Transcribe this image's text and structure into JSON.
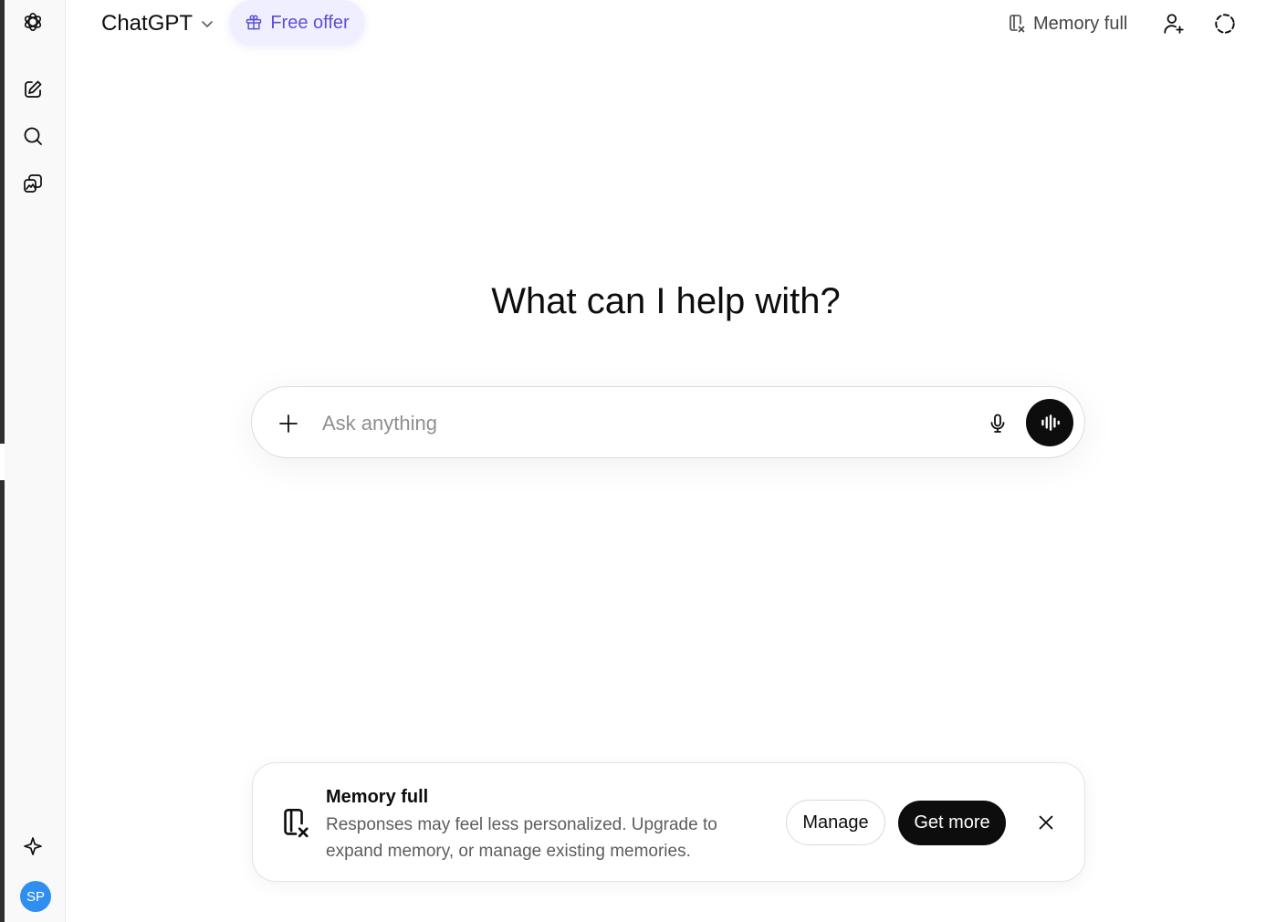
{
  "header": {
    "model_title": "ChatGPT",
    "free_offer_label": "Free offer",
    "memory_status_label": "Memory full"
  },
  "main": {
    "headline": "What can I help with?",
    "composer": {
      "placeholder": "Ask anything"
    }
  },
  "banner": {
    "title": "Memory full",
    "body": "Responses may feel less personalized. Upgrade to expand memory, or manage existing memories.",
    "manage_label": "Manage",
    "get_more_label": "Get more"
  },
  "user": {
    "initials": "SP"
  },
  "colors": {
    "accent": "#5b50d6",
    "offer_bg": "#f0efff",
    "avatar": "#2f8ff0",
    "primary_button": "#0d0d0d"
  },
  "icons": {
    "logo": "openai-logo-icon",
    "new_chat": "new-chat-icon",
    "search": "search-icon",
    "library": "library-icon",
    "sparkle": "sparkle-icon",
    "gift": "gift-icon",
    "memory": "memory-full-icon",
    "add_user": "add-user-icon",
    "temporary_chat": "temporary-chat-icon",
    "plus": "plus-icon",
    "mic": "microphone-icon",
    "voice": "voice-mode-icon",
    "close": "close-icon"
  }
}
